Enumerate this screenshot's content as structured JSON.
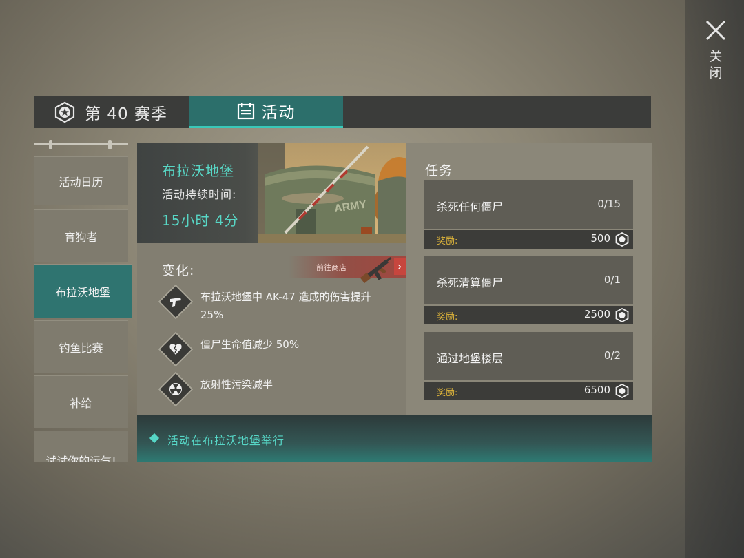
{
  "close": {
    "label": "关闭"
  },
  "tabs": [
    {
      "label": "第 40 赛季",
      "icon": "season-badge-icon",
      "active": false
    },
    {
      "label": "活动",
      "icon": "calendar-icon",
      "active": true
    }
  ],
  "sidebar": {
    "items": [
      {
        "label": "活动日历"
      },
      {
        "label": "育狗者"
      },
      {
        "label": "布拉沃地堡",
        "active": true
      },
      {
        "label": "钓鱼比赛"
      },
      {
        "label": "补给"
      },
      {
        "label": "试试你的运气!"
      }
    ]
  },
  "event": {
    "title": "布拉沃地堡",
    "duration_label": "活动持续时间:",
    "duration_value": "15小时 4分",
    "changes_label": "变化:",
    "shop_button": "前往商店",
    "changes": [
      {
        "icon": "pistol-icon",
        "text": "布拉沃地堡中 AK-47 造成的伤害提升 25%"
      },
      {
        "icon": "broken-heart-icon",
        "text": "僵尸生命值减少 50%"
      },
      {
        "icon": "radiation-icon",
        "text": "放射性污染减半"
      }
    ]
  },
  "tasks": {
    "title": "任务",
    "reward_label": "奖励:",
    "items": [
      {
        "name": "杀死任何僵尸",
        "progress": "0/15",
        "reward": "500"
      },
      {
        "name": "杀死清算僵尸",
        "progress": "0/1",
        "reward": "2500"
      },
      {
        "name": "通过地堡楼层",
        "progress": "0/2",
        "reward": "6500"
      }
    ]
  },
  "footer": {
    "text": "活动在布拉沃地堡举行"
  },
  "colors": {
    "accent": "#58d7c6",
    "reward": "#e0b63a",
    "active_tab": "#2c6f6b"
  }
}
